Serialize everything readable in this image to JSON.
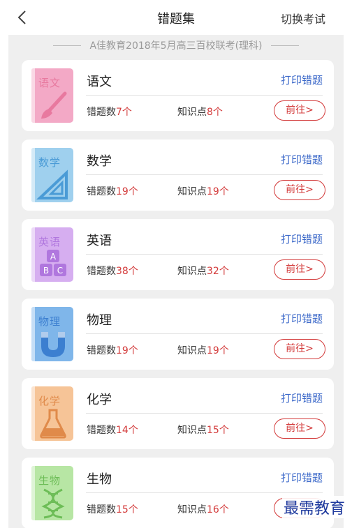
{
  "header": {
    "title": "错题集",
    "switch_label": "切换考试"
  },
  "exam_title": "A佳教育2018年5月高三百校联考(理科)",
  "labels": {
    "print": "打印错题",
    "wrong_prefix": "错题数",
    "point_prefix": "知识点",
    "goto": "前往>"
  },
  "subjects": [
    {
      "name": "语文",
      "book_text": "语文",
      "wrong": "7个",
      "points": "8个",
      "color": "#f3a9c6",
      "accent": "#e8799f",
      "icon": "paintbrush-icon"
    },
    {
      "name": "数学",
      "book_text": "数学",
      "wrong": "19个",
      "points": "19个",
      "color": "#9fd0ee",
      "accent": "#4a9bd6",
      "icon": "triangle-ruler-icon"
    },
    {
      "name": "英语",
      "book_text": "英语",
      "wrong": "38个",
      "points": "32个",
      "color": "#d6aef0",
      "accent": "#b077de",
      "icon": "abc-blocks-icon"
    },
    {
      "name": "物理",
      "book_text": "物理",
      "wrong": "19个",
      "points": "19个",
      "color": "#7fb6ea",
      "accent": "#3c7fd0",
      "icon": "magnet-icon"
    },
    {
      "name": "化学",
      "book_text": "化学",
      "wrong": "14个",
      "points": "15个",
      "color": "#f6c497",
      "accent": "#e08a4a",
      "icon": "flask-icon"
    },
    {
      "name": "生物",
      "book_text": "生物",
      "wrong": "15个",
      "points": "16个",
      "color": "#b7e6a4",
      "accent": "#6dbd57",
      "icon": "dna-icon"
    }
  ],
  "watermark": "最需教育"
}
